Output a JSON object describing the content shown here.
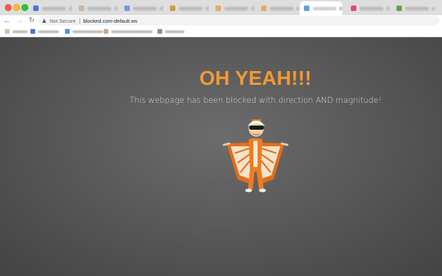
{
  "browser": {
    "colors": {
      "tab_favicons": [
        "#4a78d0",
        "#c9b7a8",
        "#7a9ad8",
        "#c8a040",
        "#e0b060",
        "#5aa0e0",
        "#d64a8a",
        "#6aa050"
      ],
      "bookmark_favicons": [
        "#d6c0a8",
        "#4a78d0",
        "#5a90e0",
        "#cfa888",
        "#909090"
      ]
    },
    "active_tab_index": 5
  },
  "toolbar": {
    "back_icon": "back-arrow-icon",
    "forward_icon": "forward-arrow-icon",
    "reload_icon": "reload-icon",
    "security_label": "Not Secure",
    "url": "blocked.com-default.ws"
  },
  "page": {
    "headline": "OH YEAH!!!",
    "subtitle": "This webpage has been blocked with direction AND magnitude!",
    "colors": {
      "headline": "#f39a32",
      "background": "#5a5a5a"
    },
    "illustration": "wingsuit-mascot-image"
  }
}
